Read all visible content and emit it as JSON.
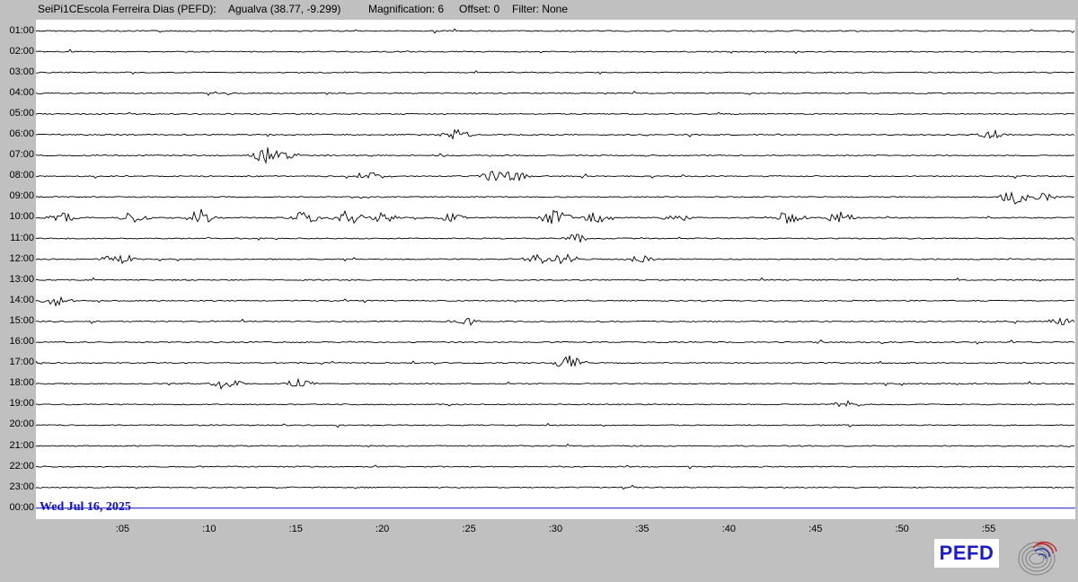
{
  "header": {
    "station": "SeiPi1CEscola Ferreira Dias (PEFD):",
    "location": "Agualva (38.77, -9.299)",
    "magnification": "Magnification: 6",
    "offset": "Offset: 0",
    "filter": "Filter: None"
  },
  "date_label": "Wed Jul 16, 2025",
  "logo_text": "PEFD",
  "chart_data": {
    "type": "line",
    "hour_labels": [
      "01:00",
      "02:00",
      "03:00",
      "04:00",
      "05:00",
      "06:00",
      "07:00",
      "08:00",
      "09:00",
      "10:00",
      "11:00",
      "12:00",
      "13:00",
      "14:00",
      "15:00",
      "16:00",
      "17:00",
      "18:00",
      "19:00",
      "20:00",
      "21:00",
      "22:00",
      "23:00",
      "00:00"
    ],
    "minute_ticks": [
      ":05",
      ":10",
      ":15",
      ":20",
      ":25",
      ":30",
      ":35",
      ":40",
      ":45",
      ":50",
      ":55"
    ],
    "x_range_minutes": [
      0,
      60
    ],
    "trace_color": "#000000",
    "current_line_color": "#1010c8",
    "current_hour_index": 23,
    "event_bursts": [
      {
        "hour_index": 6,
        "minute": 13.3,
        "amplitude": 10
      },
      {
        "hour_index": 6,
        "minute": 14.5,
        "amplitude": 5
      },
      {
        "hour_index": 7,
        "minute": 19.2,
        "amplitude": 6
      },
      {
        "hour_index": 7,
        "minute": 26.6,
        "amplitude": 10
      },
      {
        "hour_index": 7,
        "minute": 27.5,
        "amplitude": 7
      },
      {
        "hour_index": 8,
        "minute": 56.5,
        "amplitude": 9
      },
      {
        "hour_index": 8,
        "minute": 58,
        "amplitude": 6
      },
      {
        "hour_index": 9,
        "minute": 1.5,
        "amplitude": 6
      },
      {
        "hour_index": 9,
        "minute": 5.7,
        "amplitude": 8
      },
      {
        "hour_index": 9,
        "minute": 9.5,
        "amplitude": 10
      },
      {
        "hour_index": 9,
        "minute": 15.5,
        "amplitude": 8
      },
      {
        "hour_index": 9,
        "minute": 18,
        "amplitude": 9
      },
      {
        "hour_index": 9,
        "minute": 20,
        "amplitude": 7
      },
      {
        "hour_index": 9,
        "minute": 24,
        "amplitude": 5
      },
      {
        "hour_index": 9,
        "minute": 30,
        "amplitude": 10
      },
      {
        "hour_index": 9,
        "minute": 32.5,
        "amplitude": 8
      },
      {
        "hour_index": 9,
        "minute": 37,
        "amplitude": 5
      },
      {
        "hour_index": 9,
        "minute": 43.5,
        "amplitude": 10
      },
      {
        "hour_index": 9,
        "minute": 46.5,
        "amplitude": 8
      },
      {
        "hour_index": 10,
        "minute": 31.2,
        "amplitude": 6
      },
      {
        "hour_index": 11,
        "minute": 4.7,
        "amplitude": 10
      },
      {
        "hour_index": 11,
        "minute": 29,
        "amplitude": 6
      },
      {
        "hour_index": 11,
        "minute": 30.5,
        "amplitude": 7
      },
      {
        "hour_index": 11,
        "minute": 35,
        "amplitude": 5
      },
      {
        "hour_index": 13,
        "minute": 1.2,
        "amplitude": 6
      },
      {
        "hour_index": 14,
        "minute": 24.8,
        "amplitude": 6
      },
      {
        "hour_index": 14,
        "minute": 59.3,
        "amplitude": 6
      },
      {
        "hour_index": 16,
        "minute": 30.8,
        "amplitude": 9
      },
      {
        "hour_index": 17,
        "minute": 11,
        "amplitude": 8
      },
      {
        "hour_index": 17,
        "minute": 15.2,
        "amplitude": 6
      },
      {
        "hour_index": 18,
        "minute": 46.8,
        "amplitude": 5
      },
      {
        "hour_index": 5,
        "minute": 24.3,
        "amplitude": 7
      },
      {
        "hour_index": 5,
        "minute": 55.2,
        "amplitude": 6
      }
    ]
  }
}
